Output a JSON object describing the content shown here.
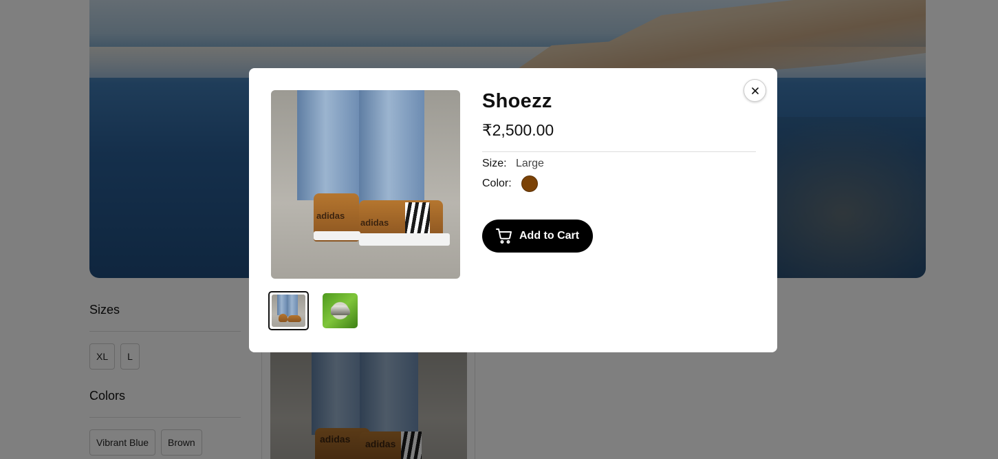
{
  "background": {
    "filters": [
      {
        "title": "Sizes",
        "chips": [
          "XL",
          "L"
        ]
      },
      {
        "title": "Colors",
        "chips": [
          "Vibrant Blue",
          "Brown"
        ]
      }
    ]
  },
  "modal": {
    "title": "Shoezz",
    "price": "₹2,500.00",
    "size_label": "Size:",
    "size_value": "Large",
    "color_label": "Color:",
    "color_value_hex": "#7b4206",
    "add_to_cart_label": "Add to Cart",
    "thumbnails": [
      {
        "icon": "sneaker-jeans-image",
        "active": true
      },
      {
        "icon": "sneaker-grass-image",
        "active": false
      }
    ],
    "close_icon": "close-icon"
  },
  "colors": {
    "overlay": "rgba(0,0,0,0.5)",
    "button_bg": "#000000",
    "swatch_brown": "#7b4206"
  }
}
